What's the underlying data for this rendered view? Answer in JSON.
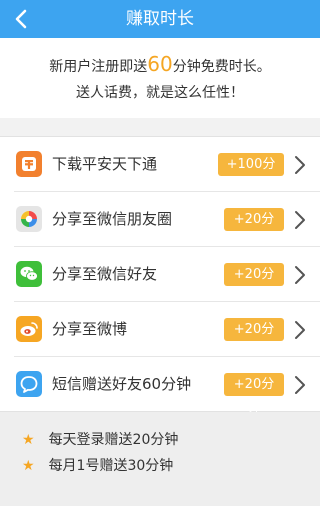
{
  "header": {
    "title": "赚取时长"
  },
  "promo": {
    "line1_pre": "新用户注册即送",
    "line1_num": "60",
    "line1_post": "分钟免费时长。",
    "line2": "送人话费，就是这么任性！",
    "highlight_color": "#f5a623"
  },
  "tasks": [
    {
      "label": "下载平安天下通",
      "badge": "+100分钟",
      "icon": "pingan-app-icon",
      "icon_color": "#f2802e"
    },
    {
      "label": "分享至微信朋友圈",
      "badge": "+20分钟",
      "icon": "wechat-moments-icon",
      "icon_color": "#e5e5e5"
    },
    {
      "label": "分享至微信好友",
      "badge": "+20分钟",
      "icon": "wechat-icon",
      "icon_color": "#3fbf3a"
    },
    {
      "label": "分享至微博",
      "badge": "+20分钟",
      "icon": "weibo-icon",
      "icon_color": "#f6a623"
    },
    {
      "label": "短信赠送好友60分钟",
      "badge": "+20分钟",
      "icon": "sms-icon",
      "icon_color": "#3da4f0"
    }
  ],
  "tips": [
    {
      "text": "每天登录赠送20分钟"
    },
    {
      "text": "每月1号赠送30分钟"
    }
  ],
  "colors": {
    "header": "#3da4f0",
    "badge": "#f6b63d",
    "star": "#f5a623"
  }
}
